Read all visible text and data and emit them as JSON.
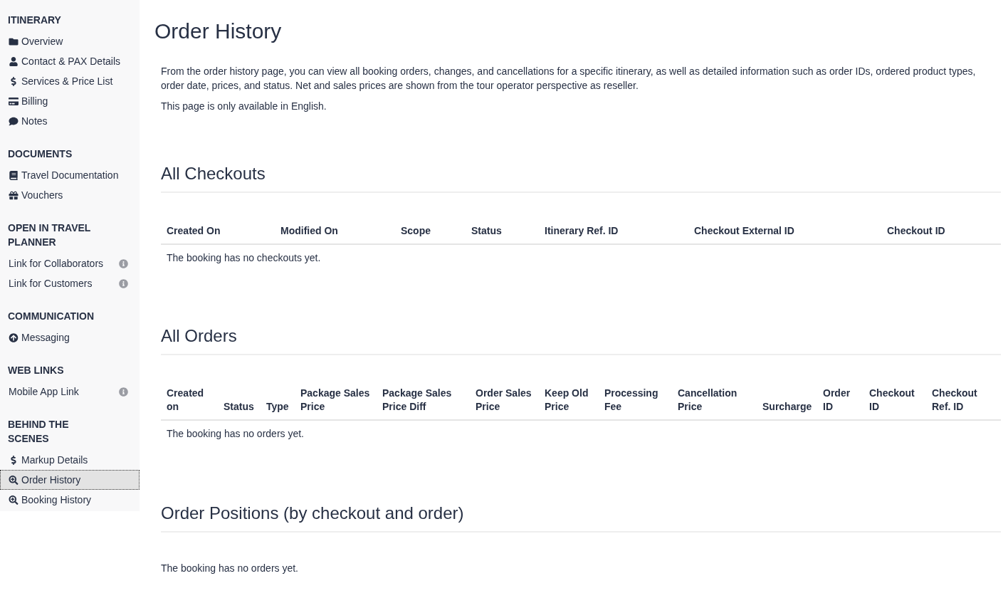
{
  "sidebar": {
    "sections": [
      {
        "title": "ITINERARY",
        "items": [
          {
            "label": "Overview",
            "kind": "folder",
            "selected": false
          },
          {
            "label": "Contact & PAX Details",
            "kind": "user",
            "selected": false
          },
          {
            "label": "Services & Price List",
            "kind": "dollar",
            "selected": false
          },
          {
            "label": "Billing",
            "kind": "card",
            "selected": false
          },
          {
            "label": "Notes",
            "kind": "comment",
            "selected": false
          }
        ]
      },
      {
        "title": "DOCUMENTS",
        "items": [
          {
            "label": "Travel Documentation",
            "kind": "book",
            "selected": false
          },
          {
            "label": "Vouchers",
            "kind": "gift",
            "selected": false
          }
        ]
      },
      {
        "title": "OPEN IN TRAVEL PLANNER",
        "items": [
          {
            "label": "Link for Collaborators",
            "kind": "info",
            "selected": false
          },
          {
            "label": "Link for Customers",
            "kind": "info",
            "selected": false
          }
        ]
      },
      {
        "title": "COMMUNICATION",
        "items": [
          {
            "label": "Messaging",
            "kind": "upload",
            "selected": false
          }
        ]
      },
      {
        "title": "WEB LINKS",
        "items": [
          {
            "label": "Mobile App Link",
            "kind": "info",
            "selected": false
          }
        ]
      },
      {
        "title": "BEHIND THE SCENES",
        "items": [
          {
            "label": "Markup Details",
            "kind": "dollar",
            "selected": false
          },
          {
            "label": "Order History",
            "kind": "search",
            "selected": true
          },
          {
            "label": "Booking History",
            "kind": "search",
            "selected": false
          }
        ]
      }
    ]
  },
  "page": {
    "title": "Order History",
    "intro": [
      "From the order history page, you can view all booking orders, changes, and cancellations for a specific itinerary, as well as detailed information such as order IDs, ordered product types, order date, prices, and status. Net and sales prices are shown from the tour operator perspective as reseller.",
      "This page is only available in English."
    ],
    "sections": [
      {
        "title": "All Checkouts",
        "kind": "checkouts",
        "table": {
          "columns": [
            "Created On",
            "Modified On",
            "Scope",
            "Status",
            "Itinerary Ref. ID",
            "Checkout External ID",
            "Checkout ID"
          ],
          "empty": "The booking has no checkouts yet."
        }
      },
      {
        "title": "All Orders",
        "kind": "orders",
        "table": {
          "columns": [
            "Created on",
            "Status",
            "Type",
            "Package Sales Price",
            "Package Sales Price Diff",
            "Order Sales Price",
            "Keep Old Price",
            "Processing Fee",
            "Cancellation Price",
            "Surcharge",
            "Order ID",
            "Checkout ID",
            "Checkout Ref. ID"
          ],
          "empty": "The booking has no orders yet."
        }
      },
      {
        "title": "Order Positions (by checkout and order)",
        "kind": "positions",
        "empty": "The booking has no orders yet."
      }
    ]
  }
}
